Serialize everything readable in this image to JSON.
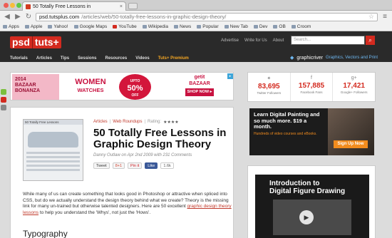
{
  "browser": {
    "tab_title": "50 Totally Free Lessons in",
    "tab_close": "×",
    "url_host": "psd.tutsplus.com",
    "url_path": "/articles/web/50-totally-free-lessons-in-graphic-design-theory/",
    "back": "◀",
    "forward": "▶",
    "reload": "↻",
    "star": "☆",
    "menu": "≡",
    "bookmarks": [
      "Apps",
      "Apple",
      "Yahoo!",
      "Google Maps",
      "YouTube",
      "Wikipedia",
      "News",
      "Popular",
      "New Tab",
      "Dev",
      "OB",
      "Croom"
    ]
  },
  "site": {
    "logo_left": "psd",
    "logo_right": "tuts+",
    "topnav": [
      "Advertise",
      "Write for Us",
      "About"
    ],
    "search_placeholder": "Search...",
    "search_icon": "⌕",
    "mainnav": [
      "Tutorials",
      "Articles",
      "Tips",
      "Sessions",
      "Resources",
      "Videos"
    ],
    "premium": "Tuts+ Premium",
    "graphicriver": "graphicriver",
    "graphicriver_tagline": "Graphics, Vectors and Print"
  },
  "ad_banner": {
    "bazaar_lines": [
      "2014",
      "BAZAAR",
      "BONANZA"
    ],
    "women": "WOMEN",
    "watches": "WATCHES",
    "upto": "UPTO",
    "off": "50%",
    "off2": "OFF",
    "getit": "getit",
    "getit2": "BAZAAR",
    "shop": "SHOP NOW ▸",
    "close": "▸"
  },
  "article": {
    "thumb_caption": "50 Totally Free Lessons",
    "category": "Articles",
    "subcategory": "Web Roundups",
    "rating_label": "Rating:",
    "stars": "★★★★",
    "title": "50 Totally Free Lessons in Graphic Design Theory",
    "byline": "Danny Outlaw on Apr 2nd 2009 with 231 Comments",
    "share": {
      "tweet": "Tweet",
      "plus": "8+1",
      "pin": "Pin it",
      "like": "Like",
      "count": "1.6k"
    },
    "intro_text": "While many of us can create something that looks good in Photoshop or attractive when spliced into CSS, but do we actually understand the design theory behind what we create? Theory is the missing link for many un-trained but otherwise talented designers. Here are 50 excellent ",
    "intro_link": "graphic design theory lessons",
    "intro_end": " to help you understand the 'Whys', not just the 'Hows'.",
    "subhead": "Typography"
  },
  "stats": [
    {
      "icon": "twitter-icon",
      "glyph": "✦",
      "num": "83,695",
      "label": "Twitter Followers"
    },
    {
      "icon": "facebook-icon",
      "glyph": "f",
      "num": "157,885",
      "label": "Facebook Fans"
    },
    {
      "icon": "googleplus-icon",
      "glyph": "g+",
      "num": "17,421",
      "label": "Google+ Followers"
    }
  ],
  "ad_painting": {
    "headline": "Learn Digital Painting and so much more. $19 a month.",
    "small": "Hundreds of video courses and eBooks.",
    "button": "Sign Up Now"
  },
  "ad_figure": {
    "title_1": "Introduction to",
    "title_2": "Digital Figure Drawing",
    "play": "▶"
  },
  "colors": {
    "accent": "#d32a1f",
    "header": "#2a2a2a"
  }
}
